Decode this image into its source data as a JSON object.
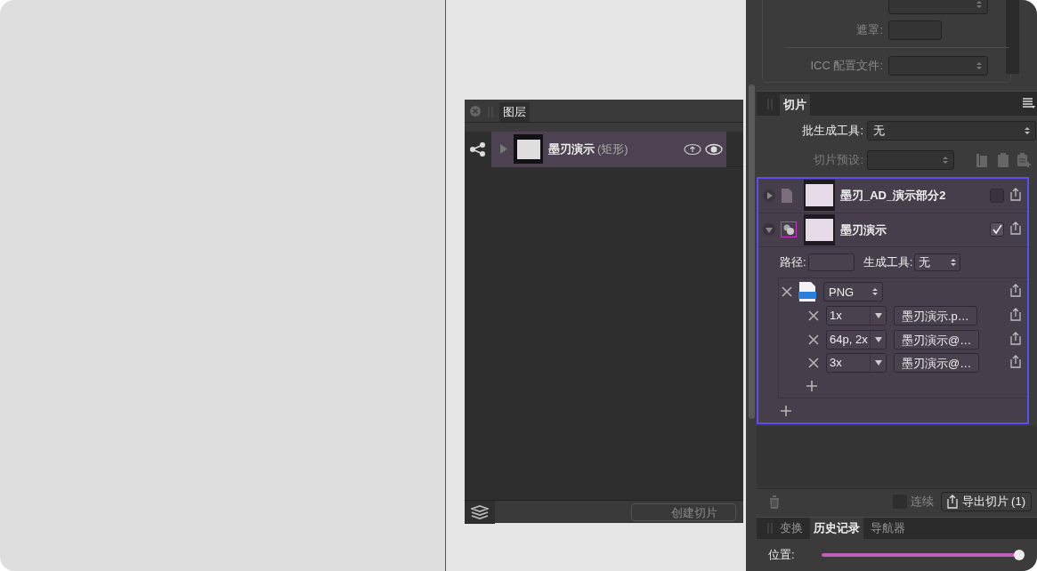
{
  "layers_panel": {
    "tabs": [
      {
        "label": "图层",
        "selected": true
      }
    ],
    "layers": [
      {
        "name": "墨刃演示",
        "type_label": "(矩形)",
        "selected": true,
        "expanded": false
      }
    ],
    "create_slice_button": "创建切片"
  },
  "export_options": {
    "mask_label": "遮罩:",
    "icc_label": "ICC 配置文件:"
  },
  "slices_panel": {
    "tabs": [
      {
        "label": "切片",
        "selected": true
      }
    ],
    "batch_label": "批生成工具:",
    "batch_value": "无",
    "preset_label": "切片预设:",
    "slices": [
      {
        "kind": "document",
        "name": "墨刃_AD_演示部分2",
        "expanded": false,
        "checked": false
      },
      {
        "kind": "layer",
        "name": "墨刃演示",
        "expanded": true,
        "checked": true,
        "path_label": "路径:",
        "generator_label": "生成工具:",
        "generator_value": "无",
        "formats": [
          {
            "format": "PNG",
            "sizes": [
              {
                "scale": "1x",
                "filename": "墨刃演示.p…"
              },
              {
                "scale": "64p, 2x",
                "filename": "墨刃演示@…"
              },
              {
                "scale": "3x",
                "filename": "墨刃演示@…"
              }
            ]
          }
        ]
      }
    ],
    "continuous_label": "连续",
    "continuous_checked": false,
    "export_button": "导出切片 (1)"
  },
  "bottom_panel": {
    "tabs": [
      {
        "label": "变换",
        "selected": false
      },
      {
        "label": "历史记录",
        "selected": true
      },
      {
        "label": "导航器",
        "selected": false
      }
    ],
    "position_slider": {
      "label": "位置:",
      "level": 1.0
    }
  }
}
